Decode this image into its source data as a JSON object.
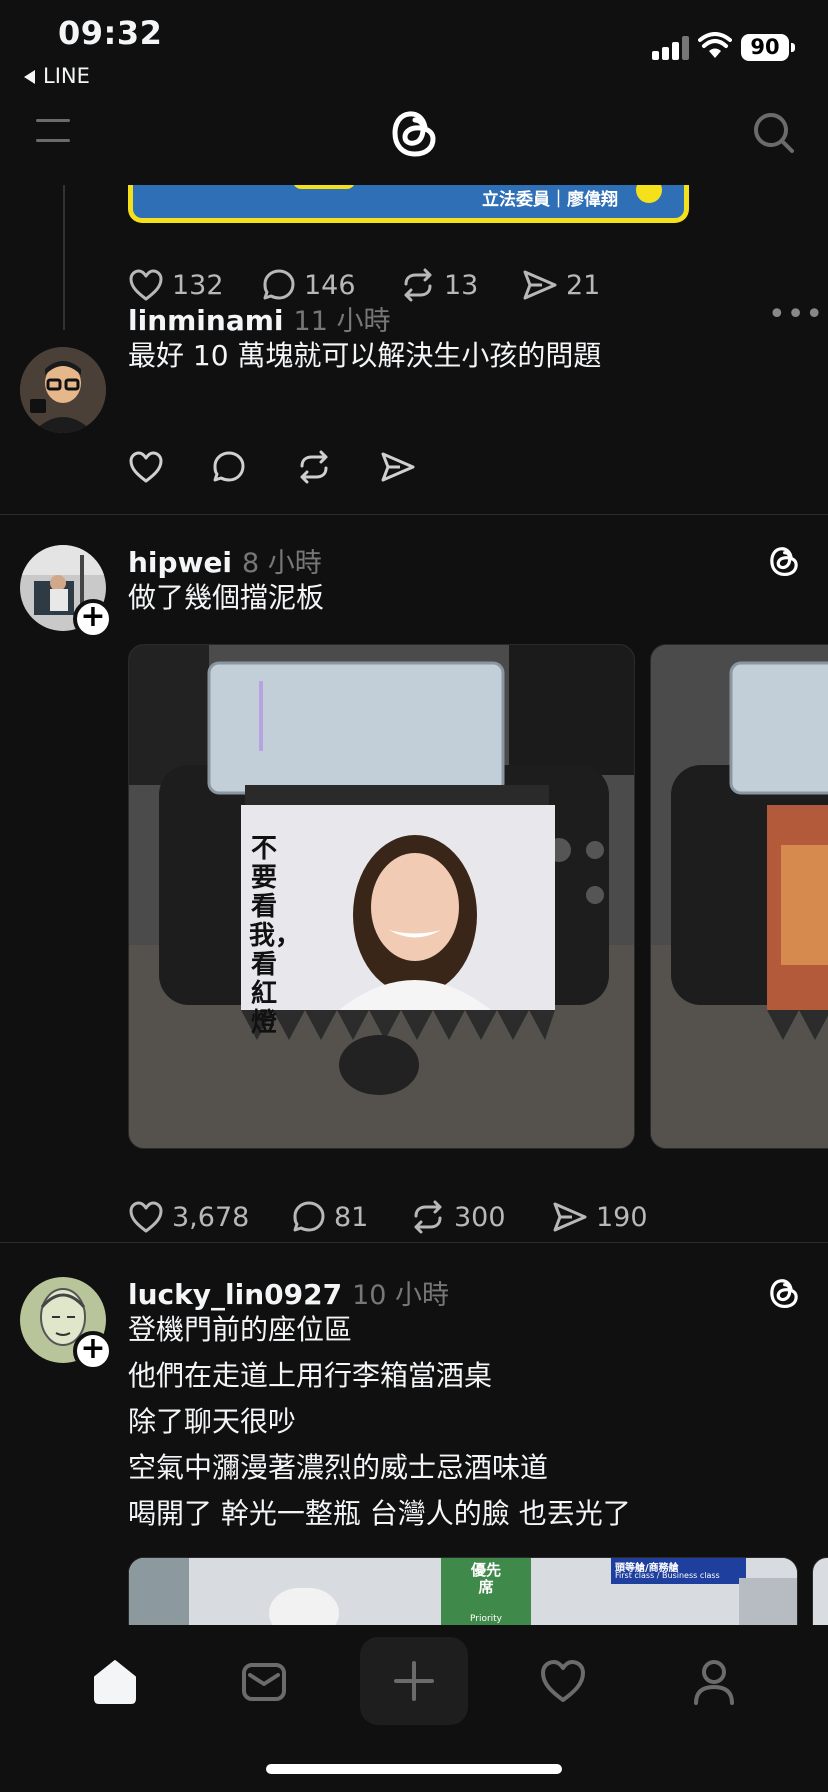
{
  "status_bar": {
    "time": "09:32",
    "back_label": "LINE",
    "battery": "90"
  },
  "header": {
    "logo_icon": "threads-logo-icon",
    "menu_icon": "menu-icon",
    "search_icon": "search-icon"
  },
  "prev_post": {
    "banner_text": "立法委員｜廖偉翔",
    "likes": "132",
    "comments": "146",
    "reposts": "13",
    "shares": "21"
  },
  "reply": {
    "username": "linminami",
    "time": "11 小時",
    "text": "最好 10 萬塊就可以解決生小孩的問題",
    "more": "•••"
  },
  "post1": {
    "username": "hipwei",
    "time": "8 小時",
    "text": "做了幾個擋泥板",
    "image_caption": "不要看我，看紅燈",
    "likes": "3,678",
    "comments": "81",
    "reposts": "300",
    "shares": "190"
  },
  "post2": {
    "username": "lucky_lin0927",
    "time": "10 小時",
    "lines": [
      "登機門前的座位區",
      "他們在走道上用行李箱當酒桌",
      "除了聊天很吵",
      "空氣中瀰漫著濃烈的威士忌酒味道",
      "喝開了  幹光一整瓶  台灣人的臉 也丟光了"
    ],
    "image_sign1": "優先席",
    "image_sign1_en": "Priority",
    "image_sign2": "頭等艙/商務艙",
    "image_sign2_en": "First class / Business class"
  },
  "tabbar": {
    "items": [
      "home-icon",
      "inbox-icon",
      "create-icon",
      "activity-icon",
      "profile-icon"
    ]
  },
  "colors": {
    "background": "#101010",
    "text": "#f3f5f7",
    "muted": "#777777"
  }
}
